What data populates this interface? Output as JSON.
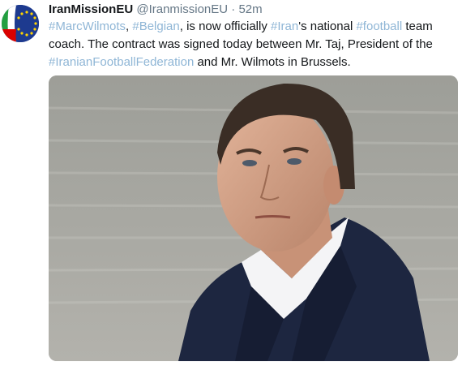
{
  "tweet": {
    "display_name": "IranMissionEU",
    "handle": "@IranmissionEU",
    "separator": "·",
    "time": "52m",
    "text_segments": [
      {
        "text": "#MarcWilmots",
        "type": "hashtag"
      },
      {
        "text": ", ",
        "type": "text"
      },
      {
        "text": "#Belgian",
        "type": "hashtag"
      },
      {
        "text": ", is now officially ",
        "type": "text"
      },
      {
        "text": "#Iran",
        "type": "hashtag"
      },
      {
        "text": "'s national ",
        "type": "text"
      },
      {
        "text": "#football",
        "type": "hashtag"
      },
      {
        "text": " team coach. The contract was signed today between Mr. Taj, President of the ",
        "type": "text"
      },
      {
        "text": "#IranianFootballFederation",
        "type": "hashtag"
      },
      {
        "text": " and Mr. Wilmots in Brussels.",
        "type": "text"
      }
    ]
  },
  "colors": {
    "hashtag": "#8fb6d6",
    "name": "#14171a",
    "meta": "#657786",
    "eu_blue": "#1d3a8f",
    "star_yellow": "#ffd400",
    "iran_green": "#239f40",
    "iran_red": "#da0000"
  },
  "icons": {
    "avatar": "iran-eu-flag-avatar",
    "media": "photo-of-coach"
  }
}
